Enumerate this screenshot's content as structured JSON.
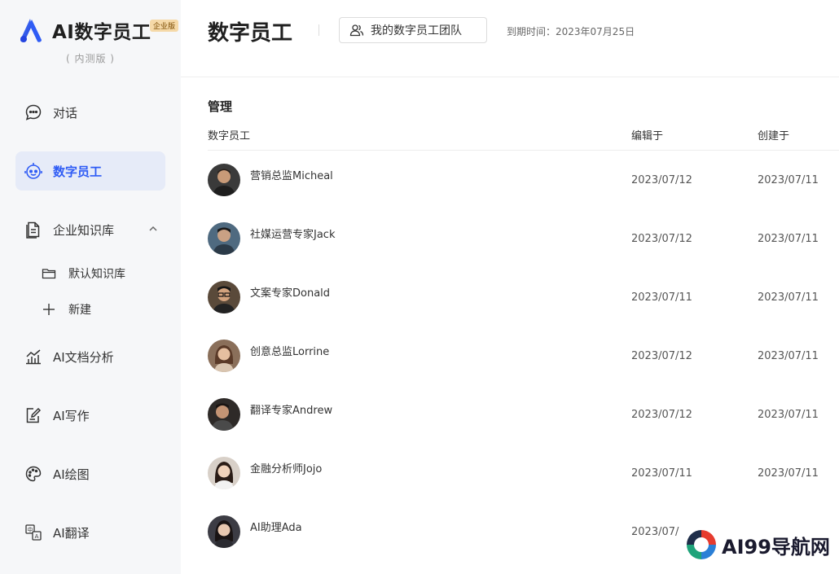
{
  "brand": {
    "name": "AI数字员工",
    "badge": "企业版",
    "subtitle": "( 内测版 )"
  },
  "sidebar": {
    "items": [
      {
        "label": "对话",
        "icon": "chat-bubble-icon"
      },
      {
        "label": "数字员工",
        "icon": "robot-icon",
        "active": true
      },
      {
        "label": "企业知识库",
        "icon": "document-icon",
        "expanded": true
      },
      {
        "label": "AI文档分析",
        "icon": "chart-icon"
      },
      {
        "label": "AI写作",
        "icon": "edit-icon"
      },
      {
        "label": "AI绘图",
        "icon": "palette-icon"
      },
      {
        "label": "AI翻译",
        "icon": "translate-icon"
      }
    ],
    "sub_items": [
      {
        "label": "默认知识库",
        "icon": "folder-icon"
      },
      {
        "label": "新建",
        "icon": "plus-icon"
      }
    ]
  },
  "header": {
    "title": "数字员工",
    "team_button": "我的数字员工团队",
    "expiry": "到期时间：2023年07月25日"
  },
  "table": {
    "section_title": "管理",
    "columns": [
      "数字员工",
      "编辑于",
      "创建于"
    ],
    "rows": [
      {
        "name": "营销总监Micheal",
        "edited": "2023/07/12",
        "created": "2023/07/11"
      },
      {
        "name": "社媒运营专家Jack",
        "edited": "2023/07/12",
        "created": "2023/07/11"
      },
      {
        "name": "文案专家Donald",
        "edited": "2023/07/11",
        "created": "2023/07/11"
      },
      {
        "name": "创意总监Lorrine",
        "edited": "2023/07/12",
        "created": "2023/07/11"
      },
      {
        "name": "翻译专家Andrew",
        "edited": "2023/07/12",
        "created": "2023/07/11"
      },
      {
        "name": "金融分析师Jojo",
        "edited": "2023/07/11",
        "created": "2023/07/11"
      },
      {
        "name": "AI助理Ada",
        "edited": "2023/07/",
        "created": ""
      }
    ]
  },
  "watermark": {
    "text": "AI99导航网"
  },
  "colors": {
    "accent": "#2f5cf5",
    "active_bg": "#e6ebf8",
    "sidebar_bg": "#f6f7f9"
  }
}
